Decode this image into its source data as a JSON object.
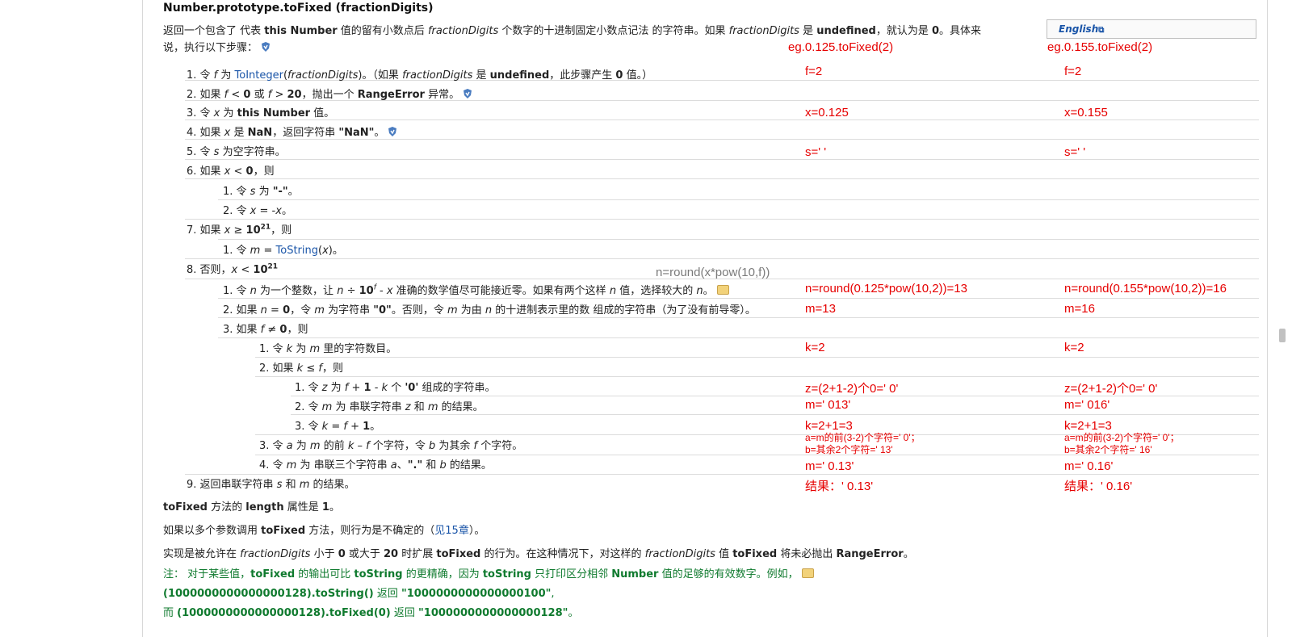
{
  "english_link": "English",
  "heading": "Number.prototype.toFixed (fractionDigits)",
  "intro": {
    "p1": "返回一个包含了 代表 ",
    "b1": "this Number",
    "p2": " 值的留有小数点后 ",
    "i1": "fractionDigits",
    "p3": " 个数字的十进制固定小数点记法 的字符串。如果 ",
    "i2": "fractionDigits",
    "p4": " 是 ",
    "b2": "undefined",
    "p5": "，就认为是 ",
    "b3": "0",
    "p6": "。具体来",
    "line2": "说，执行以下步骤："
  },
  "steps": {
    "s1": {
      "a": "1. 令 ",
      "v": "f",
      "b": " 为 ",
      "link": "ToInteger",
      "c": "(",
      "v2": "fractionDigits",
      "d": ")。（如果 ",
      "v3": "fractionDigits",
      "e": " 是 ",
      "bold": "undefined",
      "f": "，此步骤产生 ",
      "bold2": "0",
      "g": " 值。）"
    },
    "s2": {
      "a": "2. 如果 ",
      "v": "f",
      "b": " < ",
      "bold": "0",
      "c": " 或 ",
      "v2": "f",
      "d": " > ",
      "bold2": "20",
      "e": "，抛出一个 ",
      "bold3": "RangeError",
      "f": " 异常。"
    },
    "s3": {
      "a": "3. 令 ",
      "v": "x",
      "b": " 为 ",
      "bold": "this Number",
      "c": " 值。"
    },
    "s4": {
      "a": "4. 如果 ",
      "v": "x",
      "b": " 是 ",
      "bold": "NaN",
      "c": "，返回字符串 ",
      "bold2": "\"NaN\"",
      "d": "。"
    },
    "s5": {
      "a": "5. 令 ",
      "v": "s",
      "b": " 为空字符串。"
    },
    "s6": {
      "a": "6. 如果 ",
      "v": "x",
      "b": " < ",
      "bold": "0",
      "c": "，则"
    },
    "s6_1": {
      "a": "1. 令 ",
      "v": "s",
      "b": " 为 ",
      "bold": "\"-\"",
      "c": "。"
    },
    "s6_2": {
      "a": "2. 令 ",
      "v": "x",
      "b": " = -",
      "v2": "x",
      "c": "。"
    },
    "s7": {
      "a": "7. 如果 ",
      "v": "x",
      "b": " ≥ ",
      "bold": "10",
      "sup": "21",
      "c": "，则"
    },
    "s7_1": {
      "a": "1. 令 ",
      "v": "m",
      "b": " = ",
      "link": "ToString",
      "c": "(",
      "v2": "x",
      "d": ")。"
    },
    "s8": {
      "a": "8. 否则，",
      "v": "x",
      "b": " < ",
      "bold": "10",
      "sup": "21"
    },
    "s8_1": {
      "a": "1. 令 ",
      "v": "n",
      "b": " 为一个整数，让 ",
      "v2": "n",
      "c": " ÷ ",
      "bold": "10",
      "sup": "f",
      "d": " - ",
      "v3": "x",
      "e": " 准确的数学值尽可能接近零。如果有两个这样 ",
      "v4": "n",
      "f": " 值，选择较大的 ",
      "v5": "n",
      "g": "。"
    },
    "s8_2": {
      "a": "2. 如果 ",
      "v": "n",
      "b": " = ",
      "bold": "0",
      "c": "，令 ",
      "v2": "m",
      "d": " 为字符串 ",
      "bold2": "\"0\"",
      "e": "。否则，令 ",
      "v3": "m",
      "f": " 为由 ",
      "v4": "n",
      "g": " 的十进制表示里的数 组成的字符串（为了没有前导零）。"
    },
    "s8_3": {
      "a": "3. 如果 ",
      "v": "f",
      "b": " ≠ ",
      "bold": "0",
      "c": "，则"
    },
    "s8_3_1": {
      "a": "1. 令 ",
      "v": "k",
      "b": " 为 ",
      "v2": "m",
      "c": " 里的字符数目。"
    },
    "s8_3_2": {
      "a": "2. 如果 ",
      "v": "k",
      "b": " ≤ ",
      "v2": "f",
      "c": "，则"
    },
    "s8_3_2_1": {
      "a": "1. 令 ",
      "v": "z",
      "b": " 为 ",
      "v2": "f",
      "c": " + ",
      "bold": "1",
      "d": " - ",
      "v3": "k",
      "e": " 个 ",
      "bold2": "'0'",
      "f": " 组成的字符串。"
    },
    "s8_3_2_2": {
      "a": "2. 令 ",
      "v": "m",
      "b": " 为 串联字符串 ",
      "v2": "z",
      "c": " 和 ",
      "v3": "m",
      "d": " 的结果。"
    },
    "s8_3_2_3": {
      "a": "3. 令 ",
      "v": "k",
      "b": " = ",
      "v2": "f",
      "c": " + ",
      "bold": "1",
      "d": "。"
    },
    "s8_3_3": {
      "a": "3. 令 ",
      "v": "a",
      "b": " 为 ",
      "v2": "m",
      "c": " 的前 ",
      "v3": "k",
      "d": " – ",
      "v4": "f",
      "e": " 个字符，令 ",
      "v5": "b",
      "f": " 为其余 ",
      "v6": "f",
      "g": " 个字符。"
    },
    "s8_3_4": {
      "a": "4. 令 ",
      "v": "m",
      "b": " 为 串联三个字符串 ",
      "v2": "a",
      "c": "、",
      "bold": "\".\"",
      "d": " 和 ",
      "v3": "b",
      "e": " 的结果。"
    },
    "s9": {
      "a": "9. 返回串联字符串 ",
      "v": "s",
      "b": " 和 ",
      "v2": "m",
      "c": " 的结果。"
    }
  },
  "after": {
    "l1": {
      "a": "toFixed",
      "b": " 方法的 ",
      "c": "length",
      "d": " 属性是 ",
      "e": "1",
      "f": "。"
    },
    "l2": {
      "a": "如果以多个参数调用 ",
      "b": "toFixed",
      "c": " 方法，则行为是不确定的（",
      "link": "见15章",
      "d": "）。"
    },
    "l3": {
      "a": "实现是被允许在 ",
      "i": "fractionDigits",
      "b": " 小于 ",
      "c": "0",
      "d": " 或大于 ",
      "e": "20",
      "f": " 时扩展 ",
      "g": "toFixed",
      "h": " 的行为。在这种情况下，对这样的 ",
      "i2": "fractionDigits",
      "j": " 值 ",
      "k": "toFixed",
      "l": " 将未必抛出 ",
      "m": "RangeError",
      "n": "。"
    },
    "note1": {
      "a": "注：  对于某些值，",
      "b": "toFixed",
      "c": " 的输出可比 ",
      "d": "toString",
      "e": " 的更精确，因为 ",
      "f": "toString",
      "g": " 只打印区分相邻 ",
      "h": "Number",
      "i": " 值的足够的有效数字。例如，"
    },
    "note2": {
      "a": "(1000000000000000128).toString()",
      "b": " 返回 ",
      "c": "\"1000000000000000100\"",
      "d": ","
    },
    "note3": {
      "a": "而 ",
      "b": "(1000000000000000128).toFixed(0)",
      "c": " 返回 ",
      "d": "\"1000000000000000128\"",
      "e": "。"
    }
  },
  "overlay": "n=round(x*pow(10,f))",
  "ann_a": {
    "title": "eg.0.125.toFixed(2)",
    "f": "f=2",
    "x": "x=0.125",
    "s": "s='  '",
    "n": "n=round(0.125*pow(10,2))=13",
    "m": "m=13",
    "k": "k=2",
    "z": "z=(2+1-2)个0='  0'",
    "m2": "m='  013'",
    "k2": "k=2+1=3",
    "ab1": "a=m的前(3-2)个字符='  0'；",
    "ab2": "b=其余2个字符='  13'",
    "m3": "m='  0.13'",
    "res": "结果：'  0.13'"
  },
  "ann_b": {
    "title": "eg.0.155.toFixed(2)",
    "f": "f=2",
    "x": "x=0.155",
    "s": "s='  '",
    "n": "n=round(0.155*pow(10,2))=16",
    "m": "m=16",
    "k": "k=2",
    "z": "z=(2+1-2)个0='  0'",
    "m2": "m='  016'",
    "k2": "k=2+1=3",
    "ab1": "a=m的前(3-2)个字符='  0'；",
    "ab2": "b=其余2个字符='  16'",
    "m3": "m='  0.16'",
    "res": "结果：'  0.16'"
  }
}
